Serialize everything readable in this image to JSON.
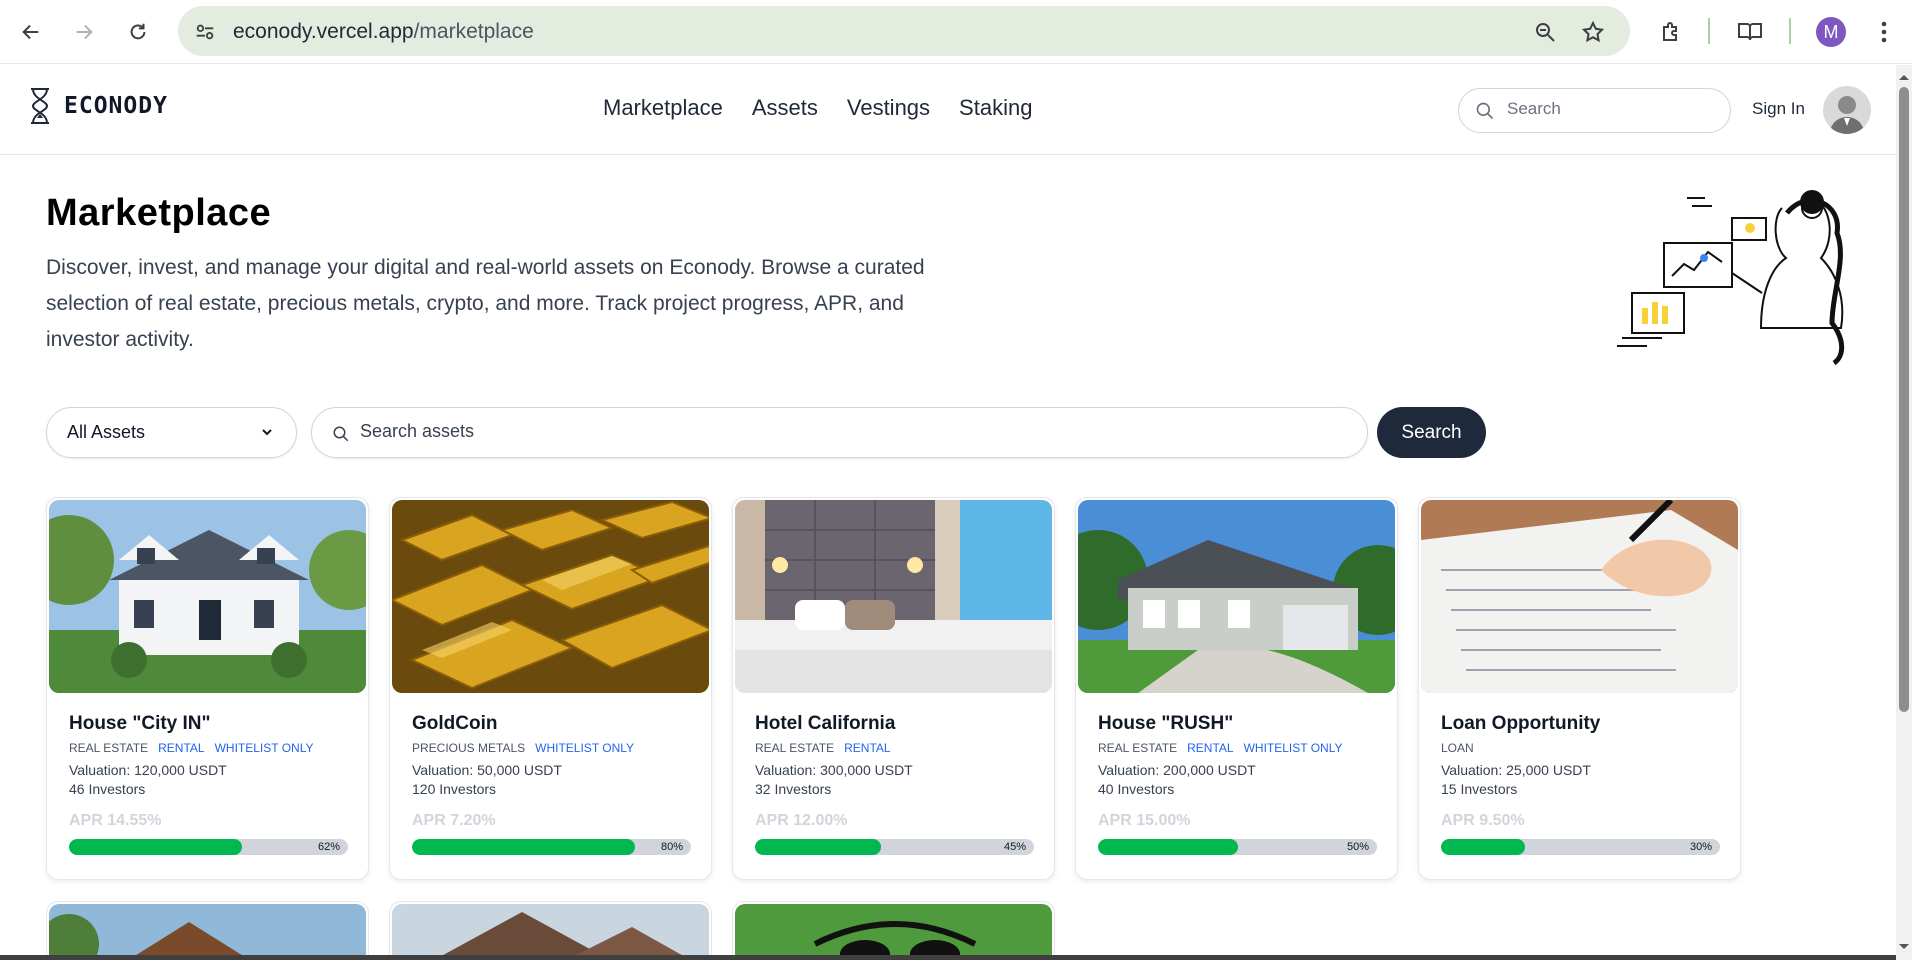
{
  "browser": {
    "url_host": "econody.vercel.app",
    "url_path": "/marketplace",
    "profile_initial": "M"
  },
  "header": {
    "logo_text": "ECONODY",
    "nav": [
      "Marketplace",
      "Assets",
      "Vestings",
      "Staking"
    ],
    "search_placeholder": "Search",
    "signin_label": "Sign In"
  },
  "hero": {
    "title": "Marketplace",
    "description": "Discover, invest, and manage your digital and real-world assets on Econody. Browse a curated selection of real estate, precious metals, crypto, and more. Track project progress, APR, and investor activity."
  },
  "filters": {
    "category_selected": "All Assets",
    "search_placeholder": "Search assets",
    "search_button": "Search"
  },
  "colors": {
    "accent_dark": "#1e293b",
    "progress_green": "#00b84f",
    "tag_blue": "#2563eb"
  },
  "assets": [
    {
      "name": "House \"City IN\"",
      "category": "REAL ESTATE",
      "tags": [
        "RENTAL",
        "WHITELIST ONLY"
      ],
      "valuation": "Valuation: 120,000 USDT",
      "investors": "46 Investors",
      "apr": "APR 14.55%",
      "progress": 62,
      "progress_label": "62%"
    },
    {
      "name": "GoldCoin",
      "category": "PRECIOUS METALS",
      "tags": [
        "WHITELIST ONLY"
      ],
      "valuation": "Valuation: 50,000 USDT",
      "investors": "120 Investors",
      "apr": "APR 7.20%",
      "progress": 80,
      "progress_label": "80%"
    },
    {
      "name": "Hotel California",
      "category": "REAL ESTATE",
      "tags": [
        "RENTAL"
      ],
      "valuation": "Valuation: 300,000 USDT",
      "investors": "32 Investors",
      "apr": "APR 12.00%",
      "progress": 45,
      "progress_label": "45%"
    },
    {
      "name": "House \"RUSH\"",
      "category": "REAL ESTATE",
      "tags": [
        "RENTAL",
        "WHITELIST ONLY"
      ],
      "valuation": "Valuation: 200,000 USDT",
      "investors": "40 Investors",
      "apr": "APR 15.00%",
      "progress": 50,
      "progress_label": "50%"
    },
    {
      "name": "Loan Opportunity",
      "category": "LOAN",
      "tags": [],
      "valuation": "Valuation: 25,000 USDT",
      "investors": "15 Investors",
      "apr": "APR 9.50%",
      "progress": 30,
      "progress_label": "30%"
    }
  ]
}
